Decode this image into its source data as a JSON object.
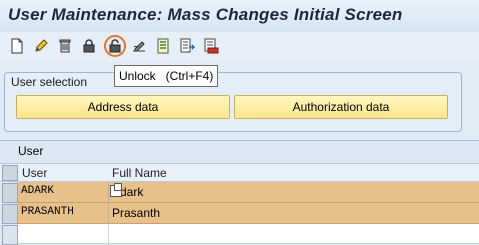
{
  "window": {
    "title": "User Maintenance: Mass Changes Initial Screen"
  },
  "toolbar": {
    "icons": [
      "new-document-icon",
      "edit-pencil-icon",
      "delete-trash-icon",
      "lock-icon",
      "unlock-icon",
      "edit-signature-icon",
      "document-list-icon",
      "document-export-icon",
      "print-preview-icon"
    ],
    "highlight_color": "#e87722"
  },
  "tooltip": {
    "text": "Unlock   (Ctrl+F4)"
  },
  "user_selection": {
    "title": "User selection",
    "address_button": "Address data",
    "authorization_button": "Authorization data"
  },
  "user_table": {
    "title": "User",
    "columns": [
      "User",
      "Full Name"
    ],
    "rows": [
      {
        "user": "ADARK",
        "full_name": "Adark",
        "selected": true
      },
      {
        "user": "PRASANTH",
        "full_name": "Prasanth",
        "selected": true
      },
      {
        "user": "",
        "full_name": "",
        "selected": false
      }
    ],
    "selected_row_color": "#e8c08a"
  }
}
